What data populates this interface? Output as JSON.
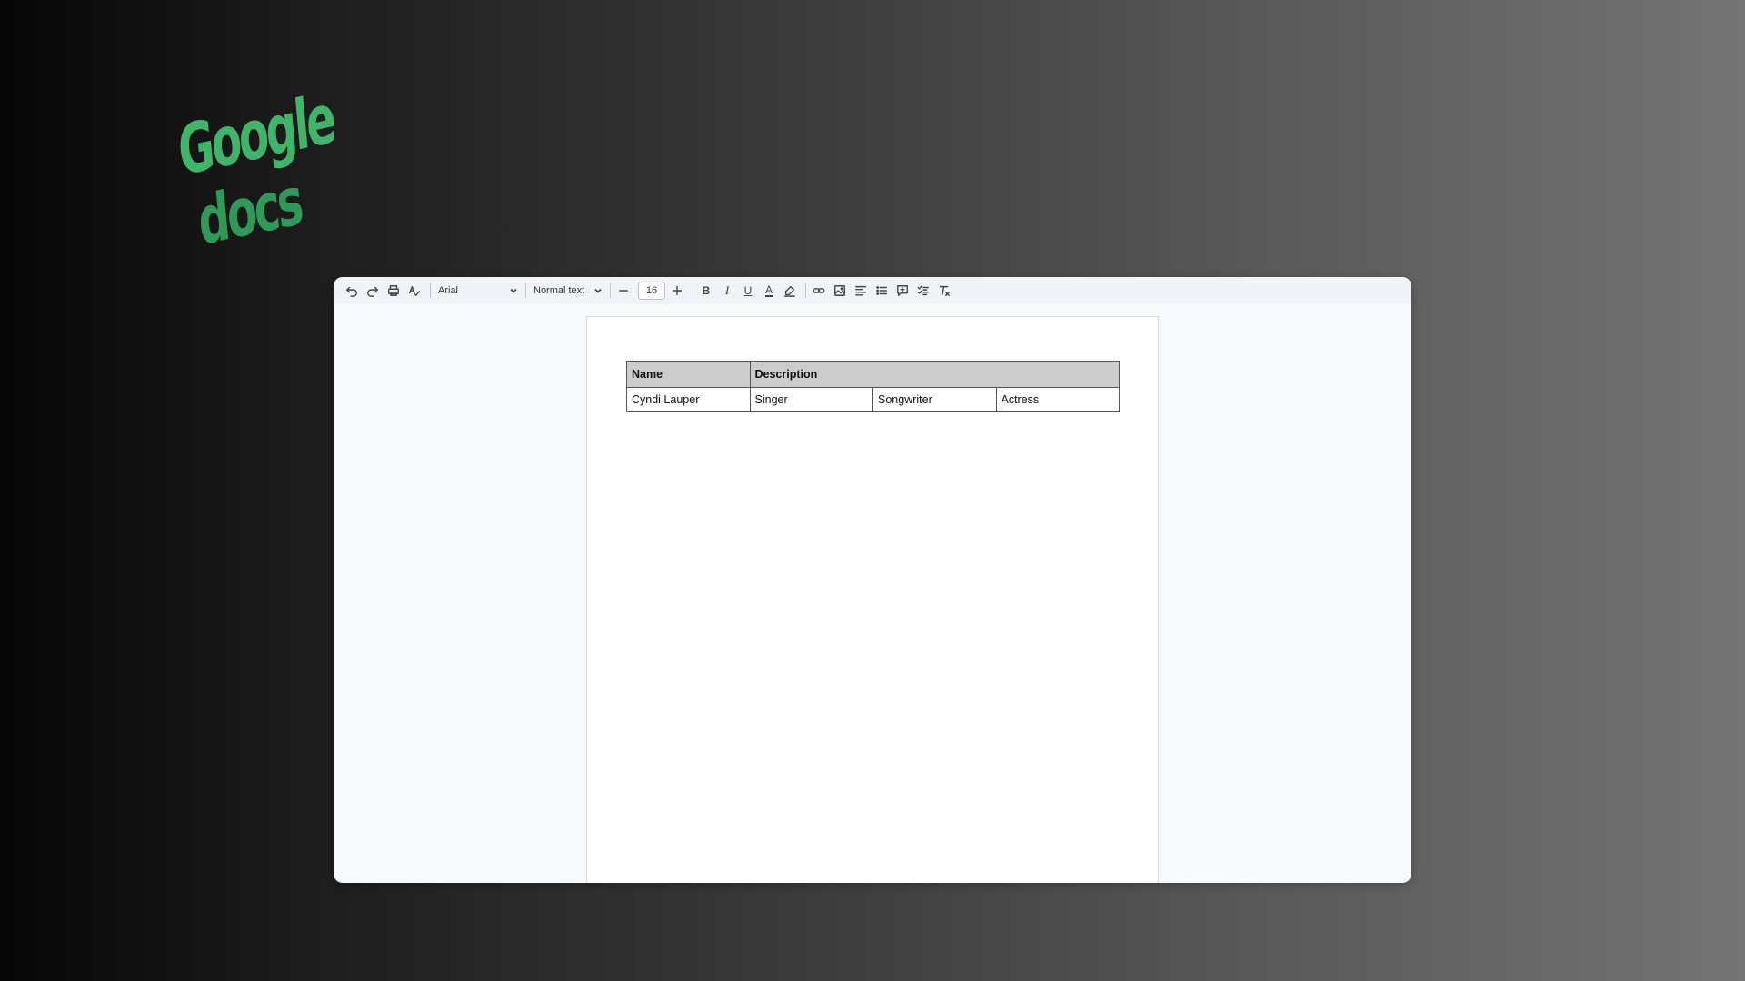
{
  "logo": {
    "line1": "Google",
    "line2": "docs"
  },
  "toolbar": {
    "undo_icon": "undo-icon",
    "redo_icon": "redo-icon",
    "print_icon": "print-icon",
    "spellcheck_icon": "spellcheck-icon",
    "font_family": "Arial",
    "text_style": "Normal text",
    "font_size": "16",
    "bold_label": "B",
    "italic_label": "I",
    "underline_label": "U",
    "text_color_label": "A"
  },
  "document": {
    "table": {
      "headers": [
        "Name",
        "Description"
      ],
      "rows": [
        [
          "Cyndi Lauper",
          "Singer",
          "Songwriter",
          "Actress"
        ]
      ]
    }
  }
}
